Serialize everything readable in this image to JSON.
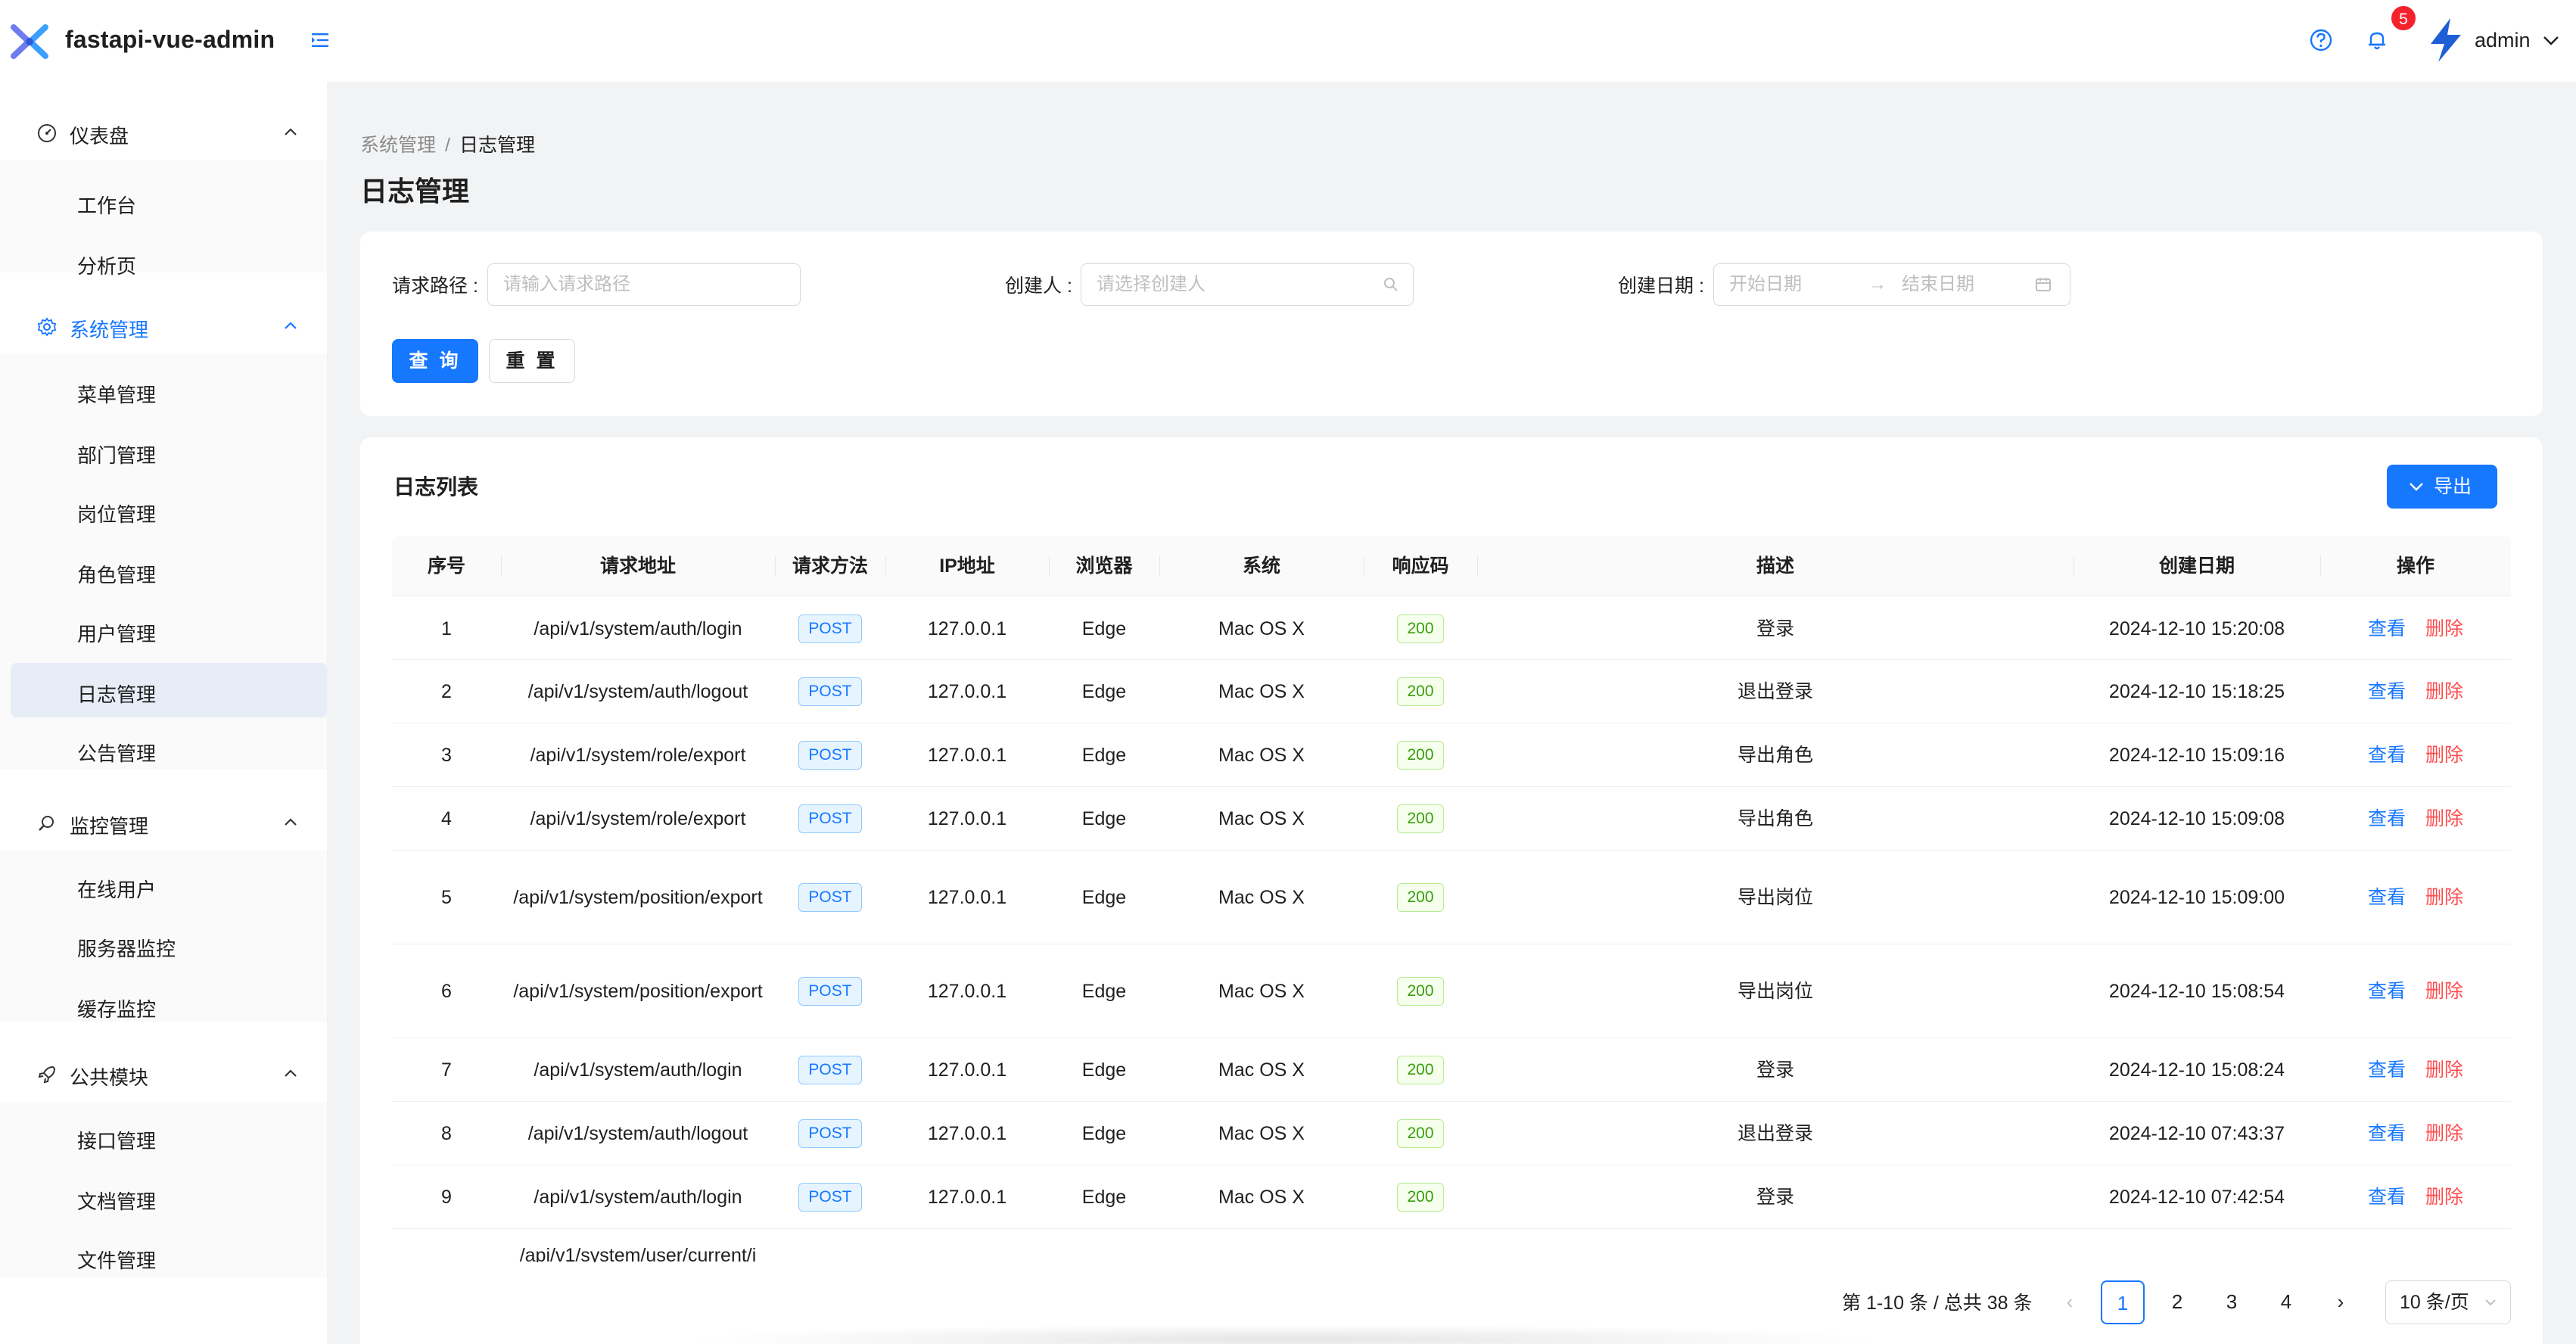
{
  "header": {
    "title": "fastapi-vue-admin",
    "badge_count": "5",
    "user_name": "admin"
  },
  "sidebar": {
    "groups": [
      {
        "label": "仪表盘",
        "items": [
          "工作台",
          "分析页"
        ]
      },
      {
        "label": "系统管理",
        "items": [
          "菜单管理",
          "部门管理",
          "岗位管理",
          "角色管理",
          "用户管理",
          "日志管理",
          "公告管理"
        ]
      },
      {
        "label": "监控管理",
        "items": [
          "在线用户",
          "服务器监控",
          "缓存监控"
        ]
      },
      {
        "label": "公共模块",
        "items": [
          "接口管理",
          "文档管理",
          "文件管理"
        ]
      }
    ],
    "selected_item": "日志管理",
    "active_group": "系统管理"
  },
  "breadcrumb": {
    "parent": "系统管理",
    "separator": "/",
    "current": "日志管理"
  },
  "page_title": "日志管理",
  "search": {
    "path_label": "请求路径 :",
    "path_placeholder": "请输入请求路径",
    "creator_label": "创建人 :",
    "creator_placeholder": "请选择创建人",
    "date_label": "创建日期 :",
    "start_placeholder": "开始日期",
    "end_placeholder": "结束日期",
    "query_button": "查 询",
    "reset_button": "重 置"
  },
  "list": {
    "title": "日志列表",
    "export_button": "导出"
  },
  "table": {
    "columns": [
      "序号",
      "请求地址",
      "请求方法",
      "IP地址",
      "浏览器",
      "系统",
      "响应码",
      "描述",
      "创建日期",
      "操作"
    ],
    "rows": [
      {
        "no": "1",
        "path": "/api/v1/system/auth/login",
        "method": "POST",
        "ip": "127.0.0.1",
        "browser": "Edge",
        "os": "Mac OS X",
        "code": "200",
        "desc": "登录",
        "date": "2024-12-10 15:20:08"
      },
      {
        "no": "2",
        "path": "/api/v1/system/auth/logout",
        "method": "POST",
        "ip": "127.0.0.1",
        "browser": "Edge",
        "os": "Mac OS X",
        "code": "200",
        "desc": "退出登录",
        "date": "2024-12-10 15:18:25"
      },
      {
        "no": "3",
        "path": "/api/v1/system/role/export",
        "method": "POST",
        "ip": "127.0.0.1",
        "browser": "Edge",
        "os": "Mac OS X",
        "code": "200",
        "desc": "导出角色",
        "date": "2024-12-10 15:09:16"
      },
      {
        "no": "4",
        "path": "/api/v1/system/role/export",
        "method": "POST",
        "ip": "127.0.0.1",
        "browser": "Edge",
        "os": "Mac OS X",
        "code": "200",
        "desc": "导出角色",
        "date": "2024-12-10 15:09:08"
      },
      {
        "no": "5",
        "path": "/api/v1/system/position/export",
        "method": "POST",
        "ip": "127.0.0.1",
        "browser": "Edge",
        "os": "Mac OS X",
        "code": "200",
        "desc": "导出岗位",
        "date": "2024-12-10 15:09:00"
      },
      {
        "no": "6",
        "path": "/api/v1/system/position/export",
        "method": "POST",
        "ip": "127.0.0.1",
        "browser": "Edge",
        "os": "Mac OS X",
        "code": "200",
        "desc": "导出岗位",
        "date": "2024-12-10 15:08:54"
      },
      {
        "no": "7",
        "path": "/api/v1/system/auth/login",
        "method": "POST",
        "ip": "127.0.0.1",
        "browser": "Edge",
        "os": "Mac OS X",
        "code": "200",
        "desc": "登录",
        "date": "2024-12-10 15:08:24"
      },
      {
        "no": "8",
        "path": "/api/v1/system/auth/logout",
        "method": "POST",
        "ip": "127.0.0.1",
        "browser": "Edge",
        "os": "Mac OS X",
        "code": "200",
        "desc": "退出登录",
        "date": "2024-12-10 07:43:37"
      },
      {
        "no": "9",
        "path": "/api/v1/system/auth/login",
        "method": "POST",
        "ip": "127.0.0.1",
        "browser": "Edge",
        "os": "Mac OS X",
        "code": "200",
        "desc": "登录",
        "date": "2024-12-10 07:42:54"
      }
    ],
    "partial_row_path": "/api/v1/system/user/current/i",
    "view_label": "查看",
    "delete_label": "删除"
  },
  "pagination": {
    "total_text": "第 1-10 条 / 总共 38 条",
    "pages": [
      "1",
      "2",
      "3",
      "4"
    ],
    "current_page": "1",
    "page_size": "10 条/页"
  },
  "colors": {
    "primary": "#1677ff",
    "danger": "#ff4d4f",
    "success": "#389e0d",
    "badge": "#f5222d",
    "page_bg": "#f2f3f5"
  },
  "icons": {
    "logo": "x-logo-icon",
    "collapse": "menu-fold-icon",
    "help": "question-circle-icon",
    "bell": "bell-icon",
    "avatar": "lightning-avatar-icon",
    "dashboard": "dashboard-icon",
    "system": "gear-icon",
    "monitor": "search-monitor-icon",
    "public": "rocket-icon",
    "search": "search-icon",
    "calendar": "calendar-icon",
    "export": "chevron-down-icon"
  }
}
